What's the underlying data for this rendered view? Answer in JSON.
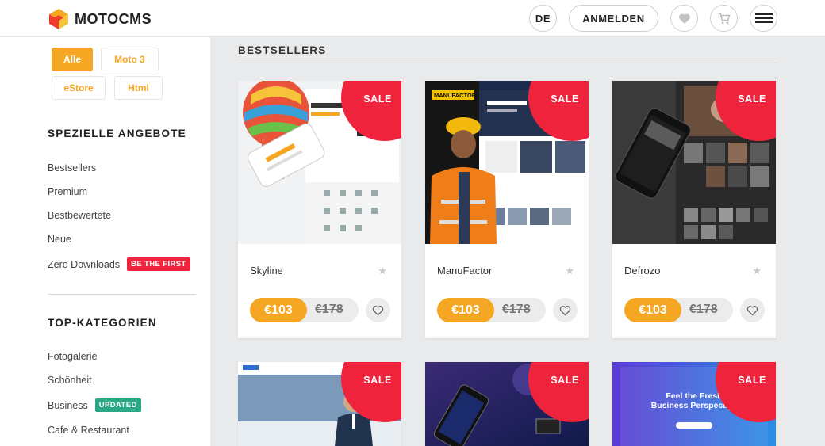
{
  "header": {
    "logo_text": "MOTOCMS",
    "lang_label": "DE",
    "login_label": "ANMELDEN"
  },
  "sidebar": {
    "filters": [
      "Alle",
      "Moto 3",
      "eStore",
      "Html"
    ],
    "special_heading": "SPEZIELLE ANGEBOTE",
    "special_items": [
      {
        "label": "Bestsellers"
      },
      {
        "label": "Premium"
      },
      {
        "label": "Bestbewertete"
      },
      {
        "label": "Neue"
      },
      {
        "label": "Zero Downloads",
        "badge": "BE THE FIRST",
        "badge_color": "#ef233c"
      }
    ],
    "top_heading": "TOP-KATEGORIEN",
    "top_items": [
      {
        "label": "Fotogalerie"
      },
      {
        "label": "Schönheit"
      },
      {
        "label": "Business",
        "badge": "UPDATED",
        "badge_color": "#2aa784"
      },
      {
        "label": "Cafe & Restaurant"
      }
    ]
  },
  "main": {
    "title": "BESTSELLERS",
    "sale_label": "SALE",
    "cards": [
      {
        "name": "Skyline",
        "price": "€103",
        "old_price": "€178"
      },
      {
        "name": "ManuFactor",
        "price": "€103",
        "old_price": "€178"
      },
      {
        "name": "Defrozo",
        "price": "€103",
        "old_price": "€178"
      }
    ],
    "row2_texts": {
      "thumb3_title": "Feel the Fresh Business Perspective"
    }
  },
  "colors": {
    "accent": "#f5a623",
    "sale": "#ef233c",
    "updated": "#2aa784"
  }
}
